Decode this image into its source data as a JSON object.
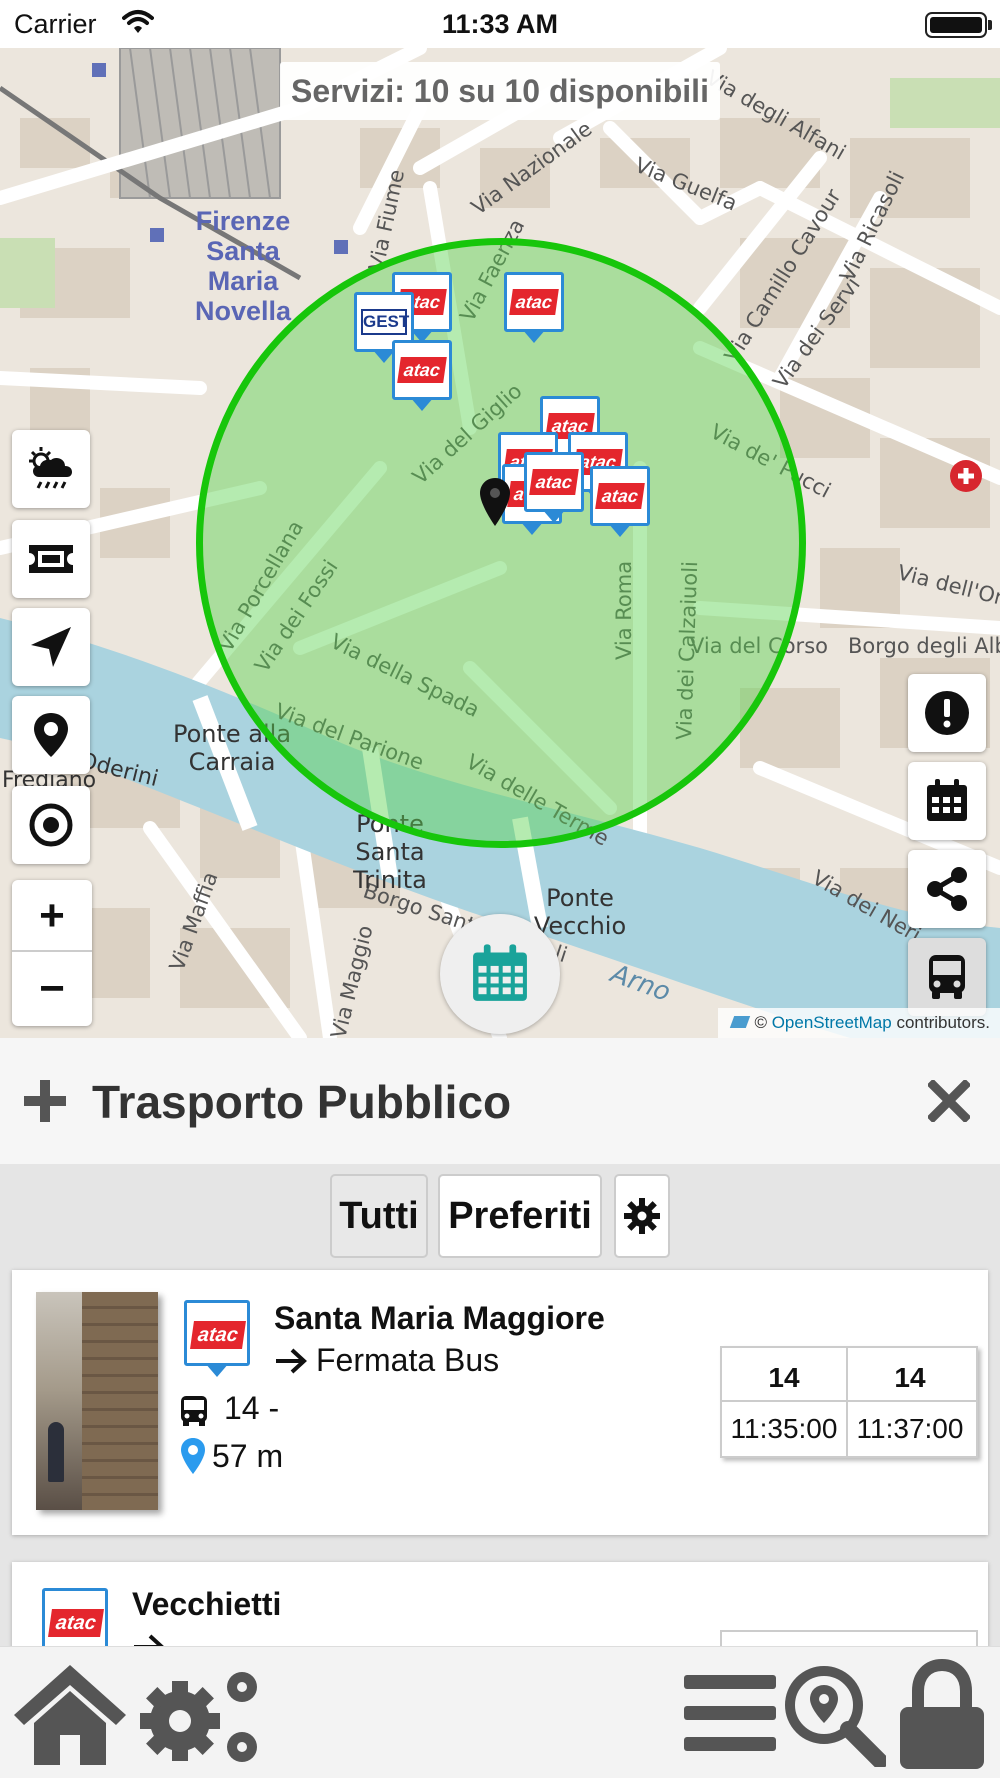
{
  "status_bar": {
    "carrier": "Carrier",
    "time": "11:33 AM"
  },
  "map": {
    "services_banner": "Servizi: 10 su 10 disponibili",
    "station_label": "Firenze Santa Maria Novella",
    "street_labels": [
      "Via Guelfa",
      "Via Nazionale",
      "Via Faenza",
      "Via Fiume",
      "Via Camillo Cavour",
      "Via Ricasoli",
      "Via del Giglio",
      "Via dei Servi",
      "Via de' Pucci",
      "Via Porcellana",
      "Via dei Fossi",
      "Via della Spada",
      "Via del Parione",
      "Via delle Terme",
      "Via Roma",
      "Via dei Calzaiuoli",
      "Via del Corso",
      "Borgo degli Albizi",
      "Via dell'Oriuolo",
      "Via dei Neri",
      "Borgo Santi Apostoli",
      "Via Maffia",
      "Via Maggio",
      "Arno",
      "Via degli Alfani"
    ],
    "place_labels": [
      "Ponte alla Carraia",
      "Ponte Santa Trinita",
      "Ponte Vecchio",
      "Frediano",
      "Oderini"
    ],
    "markers": [
      {
        "operator": "atac"
      },
      {
        "operator": "GEST"
      },
      {
        "operator": "atac"
      },
      {
        "operator": "atac"
      },
      {
        "operator": "atac"
      },
      {
        "operator": "atac"
      },
      {
        "operator": "atac"
      },
      {
        "operator": "atac"
      },
      {
        "operator": "atac"
      },
      {
        "operator": "atac"
      }
    ],
    "zoom_in": "+",
    "zoom_out": "−",
    "attribution_prefix": "©",
    "attribution_link": "OpenStreetMap",
    "attribution_suffix": "contributors.",
    "left_controls": [
      "weather-icon",
      "ticket-icon",
      "navigate-icon",
      "pin-icon",
      "target-icon"
    ],
    "right_controls": [
      "alert-icon",
      "calendar-icon",
      "share-icon",
      "bus-icon"
    ]
  },
  "panel": {
    "title": "Trasporto Pubblico"
  },
  "filters": {
    "all_label": "Tutti",
    "favorites_label": "Preferiti"
  },
  "stops": [
    {
      "name": "Santa Maria Maggiore",
      "type": "Fermata Bus",
      "lines": "14 -",
      "distance": "57 m",
      "operator_logo": "atac",
      "departures": [
        {
          "line": "14",
          "time": "11:35:00"
        },
        {
          "line": "14",
          "time": "11:37:00"
        }
      ]
    },
    {
      "name": "Vecchietti",
      "operator_logo": "atac"
    }
  ],
  "colors": {
    "radius": "#17c60b",
    "marker_border": "#2b8ad6",
    "operator_red": "#e4262d",
    "osm_link": "#0078a8",
    "icon_grey": "#555555",
    "calendar_teal": "#1aa39a"
  }
}
